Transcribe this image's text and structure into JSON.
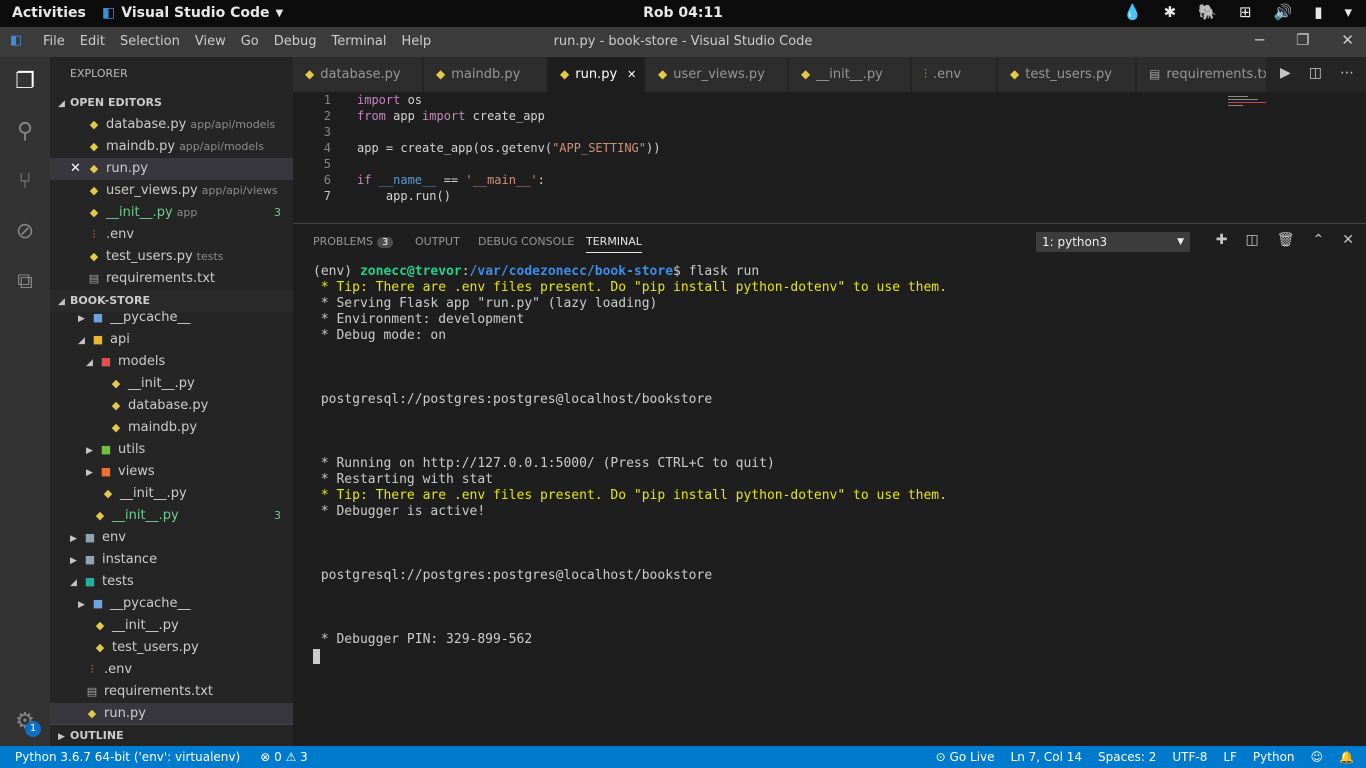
{
  "topbar": {
    "activities": "Activities",
    "app_name": "Visual Studio Code",
    "clock": "Rob 04:11"
  },
  "menubar": {
    "items": [
      "File",
      "Edit",
      "Selection",
      "View",
      "Go",
      "Debug",
      "Terminal",
      "Help"
    ],
    "window_title": "run.py - book-store - Visual Studio Code"
  },
  "sidebar": {
    "title": "EXPLORER",
    "open_editors_label": "OPEN EDITORS",
    "open_editors": [
      {
        "name": "database.py",
        "path": "app/api/models"
      },
      {
        "name": "maindb.py",
        "path": "app/api/models"
      },
      {
        "name": "run.py",
        "path": ""
      },
      {
        "name": "user_views.py",
        "path": "app/api/views"
      },
      {
        "name": "__init__.py",
        "path": "app",
        "count": "3"
      },
      {
        "name": ".env",
        "path": ""
      },
      {
        "name": "test_users.py",
        "path": "tests"
      },
      {
        "name": "requirements.txt",
        "path": ""
      }
    ],
    "project_label": "BOOK-STORE",
    "tree": [
      "__pycache__",
      "api",
      "models",
      "__init__.py",
      "database.py",
      "maindb.py",
      "utils",
      "views",
      "__init__.py",
      "__init__.py",
      "env",
      "instance",
      "tests",
      "__pycache__",
      "__init__.py",
      "test_users.py",
      ".env",
      "requirements.txt",
      "run.py"
    ],
    "tree_count": "3",
    "outline_label": "OUTLINE",
    "settings_badge": "1"
  },
  "tabs": [
    "database.py",
    "maindb.py",
    "run.py",
    "user_views.py",
    "__init__.py",
    ".env",
    "test_users.py",
    "requirements.txt"
  ],
  "editor": {
    "line_numbers": [
      "1",
      "2",
      "3",
      "4",
      "5",
      "6",
      "7"
    ],
    "code": {
      "l1a": "import",
      "l1b": " os",
      "l2a": "from",
      "l2b": " app ",
      "l2c": "import",
      "l2d": " create_app",
      "l4a": "app = create_app(os.getenv(",
      "l4b": "\"APP_SETTING\"",
      "l4c": "))",
      "l6a": "if",
      "l6b": " __name__",
      "l6c": " == ",
      "l6d": "'__main__'",
      "l6e": ":",
      "l7": "    app.run()"
    }
  },
  "panel": {
    "tabs": {
      "problems": "PROBLEMS",
      "problems_count": "3",
      "output": "OUTPUT",
      "debug": "DEBUG CONSOLE",
      "terminal": "TERMINAL"
    },
    "terminal_select": "1: python3",
    "prompt": {
      "env": "(env) ",
      "user": "zonecc@trevor",
      "colon": ":",
      "path": "/var/codezonecc/book-store",
      "cmd": "$ flask run"
    },
    "lines": [
      " * Tip: There are .env files present. Do \"pip install python-dotenv\" to use them.",
      " * Serving Flask app \"run.py\" (lazy loading)",
      " * Environment: development",
      " * Debug mode: on",
      " postgresql://postgres:postgres@localhost/bookstore",
      " * Running on http://127.0.0.1:5000/ (Press CTRL+C to quit)",
      " * Restarting with stat",
      " * Tip: There are .env files present. Do \"pip install python-dotenv\" to use them.",
      " * Debugger is active!",
      " postgresql://postgres:postgres@localhost/bookstore",
      " * Debugger PIN: 329-899-562"
    ]
  },
  "status": {
    "python": "Python 3.6.7 64-bit ('env': virtualenv)",
    "errors": "0",
    "warnings": "3",
    "golive": "Go Live",
    "position": "Ln 7, Col 14",
    "spaces": "Spaces: 2",
    "encoding": "UTF-8",
    "eol": "LF",
    "language": "Python"
  }
}
